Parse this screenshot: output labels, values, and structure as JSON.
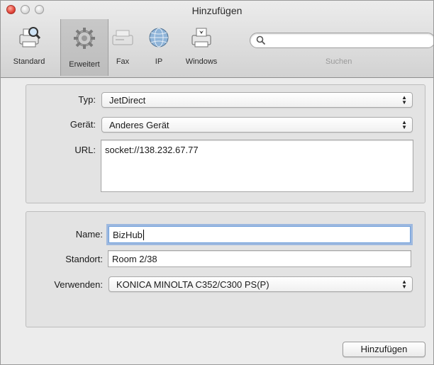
{
  "window": {
    "title": "Hinzufügen"
  },
  "toolbar": {
    "items": [
      {
        "label": "Standard"
      },
      {
        "label": "Erweitert"
      },
      {
        "label": "Fax"
      },
      {
        "label": "IP"
      },
      {
        "label": "Windows"
      }
    ],
    "search": {
      "placeholder": "",
      "label": "Suchen"
    }
  },
  "connection": {
    "type_label": "Typ:",
    "type_value": "JetDirect",
    "device_label": "Gerät:",
    "device_value": "Anderes Gerät",
    "url_label": "URL:",
    "url_value": "socket://138.232.67.77"
  },
  "printer": {
    "name_label": "Name:",
    "name_value": "BizHub",
    "location_label": "Standort:",
    "location_value": "Room 2/38",
    "use_label": "Verwenden:",
    "use_value": "KONICA MINOLTA C352/C300 PS(P)"
  },
  "actions": {
    "add_label": "Hinzufügen"
  }
}
